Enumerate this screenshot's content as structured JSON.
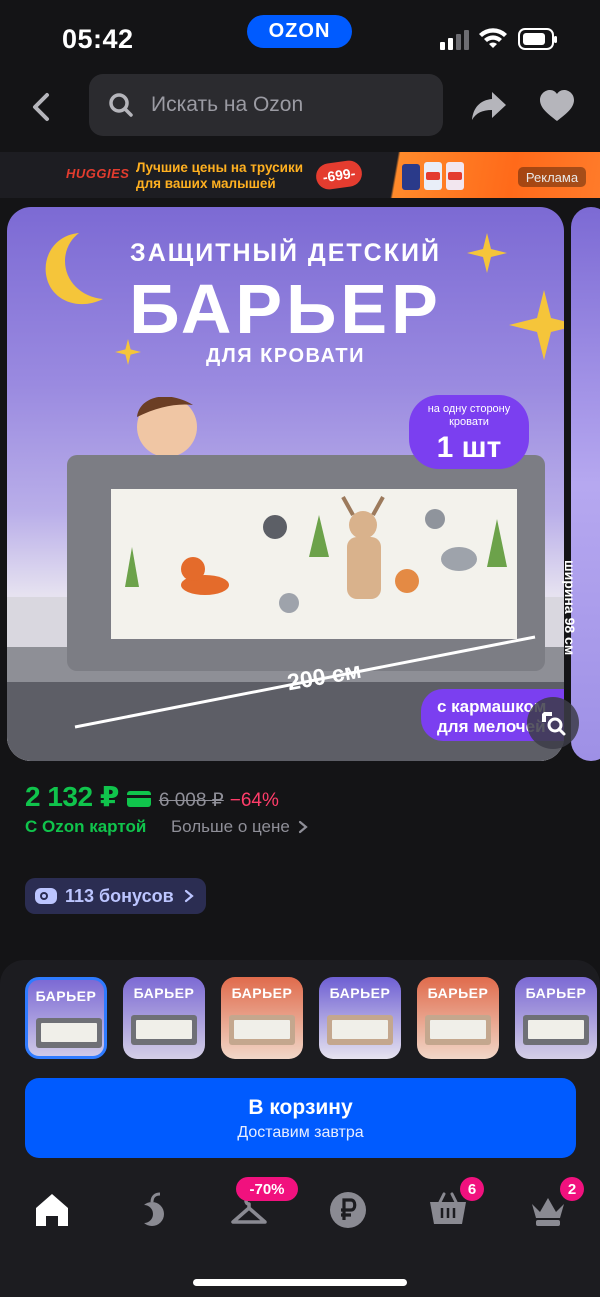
{
  "status_bar": {
    "time": "05:42",
    "brand": "OZON"
  },
  "header": {
    "search_placeholder": "Искать на Ozon"
  },
  "ad_banner": {
    "brand": "HUGGIES",
    "text": "Лучшие цены на трусики для ваших малышей",
    "price_tag": "-699-",
    "ad_label": "Реклама"
  },
  "product_image": {
    "line1": "ЗАЩИТНЫЙ ДЕТСКИЙ",
    "line2": "БАРЬЕР",
    "line3": "ДЛЯ КРОВАТИ",
    "badge_small": "на одну сторону кровати",
    "badge_big": "1 шт",
    "dimension": "200 см",
    "pocket_text": "с кармашком для мелочей",
    "next_image_text": "ширина 98 см"
  },
  "price": {
    "current": "2 132 ₽",
    "old": "6 008 ₽",
    "discount": "−64%",
    "ozon_card_label": "С Ozon картой",
    "more_price_label": "Больше о цене",
    "colors": {
      "green": "#10c44c",
      "red": "#ff3d6a"
    }
  },
  "bonus": {
    "label": "113 бонусов"
  },
  "thumbnails": [
    {
      "title": "БАРЬЕР",
      "bg": "purple",
      "selected": true
    },
    {
      "title": "БАРЬЕР",
      "bg": "purple",
      "selected": false
    },
    {
      "title": "БАРЬЕР",
      "bg": "orange",
      "selected": false
    },
    {
      "title": "БАРЬЕР",
      "bg": "purple",
      "selected": false
    },
    {
      "title": "БАРЬЕР",
      "bg": "orange",
      "selected": false
    },
    {
      "title": "БАРЬЕР",
      "bg": "purple",
      "selected": false
    }
  ],
  "cart_button": {
    "label": "В корзину",
    "sublabel": "Доставим завтра",
    "color": "#005bff"
  },
  "tab_bar": {
    "items": [
      {
        "name": "home-icon"
      },
      {
        "name": "fresh-icon"
      },
      {
        "name": "hanger-icon",
        "badge": "-70%"
      },
      {
        "name": "ruble-icon"
      },
      {
        "name": "cart-icon",
        "badge": "6"
      },
      {
        "name": "profile-icon",
        "badge": "2"
      }
    ]
  }
}
